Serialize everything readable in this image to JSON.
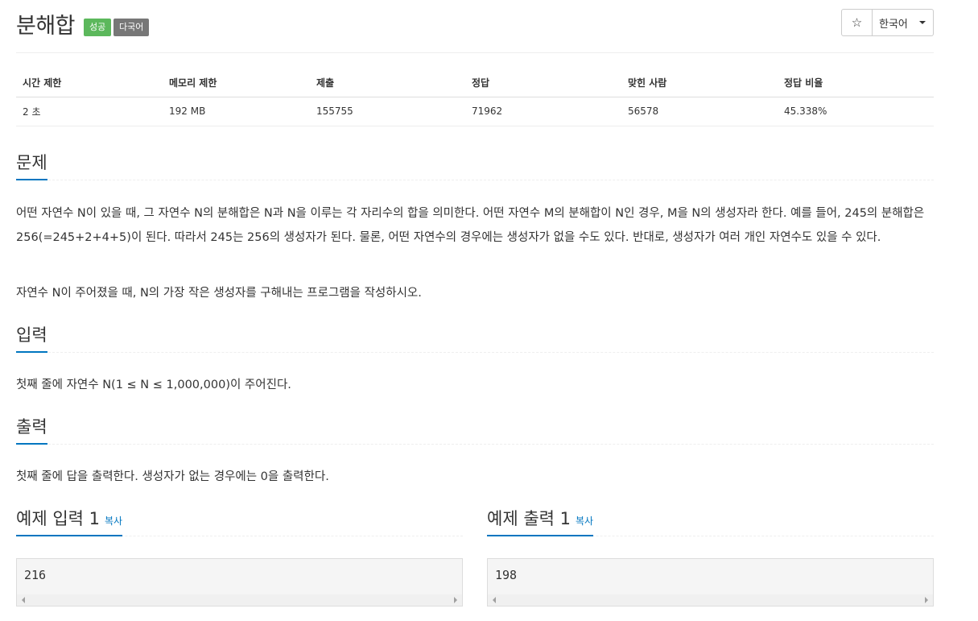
{
  "problem": {
    "title": "분해합",
    "badges": {
      "success": "성공",
      "multilang": "다국어"
    },
    "star_icon": "☆",
    "language": "한국어"
  },
  "info": {
    "headers": [
      "시간 제한",
      "메모리 제한",
      "제출",
      "정답",
      "맞힌 사람",
      "정답 비율"
    ],
    "values": [
      "2 초",
      "192 MB",
      "155755",
      "71962",
      "56578",
      "45.338%"
    ]
  },
  "sections": {
    "problem_title": "문제",
    "problem_text_1": "어떤 자연수 N이 있을 때, 그 자연수 N의 분해합은 N과 N을 이루는 각 자리수의 합을 의미한다. 어떤 자연수 M의 분해합이 N인 경우, M을 N의 생성자라 한다. 예를 들어, 245의 분해합은 256(=245+2+4+5)이 된다. 따라서 245는 256의 생성자가 된다. 물론, 어떤 자연수의 경우에는 생성자가 없을 수도 있다. 반대로, 생성자가 여러 개인 자연수도 있을 수 있다.",
    "problem_text_2": "자연수 N이 주어졌을 때, N의 가장 작은 생성자를 구해내는 프로그램을 작성하시오.",
    "input_title": "입력",
    "input_text": "첫째 줄에 자연수 N(1 ≤ N ≤ 1,000,000)이 주어진다.",
    "output_title": "출력",
    "output_text": "첫째 줄에 답을 출력한다. 생성자가 없는 경우에는 0을 출력한다."
  },
  "samples": {
    "input_title": "예제 입력 1",
    "output_title": "예제 출력 1",
    "copy_label": "복사",
    "input_value": "216",
    "output_value": "198"
  },
  "colors": {
    "accent": "#0076c0",
    "success": "#5cb85c",
    "badge_gray": "#777777"
  }
}
